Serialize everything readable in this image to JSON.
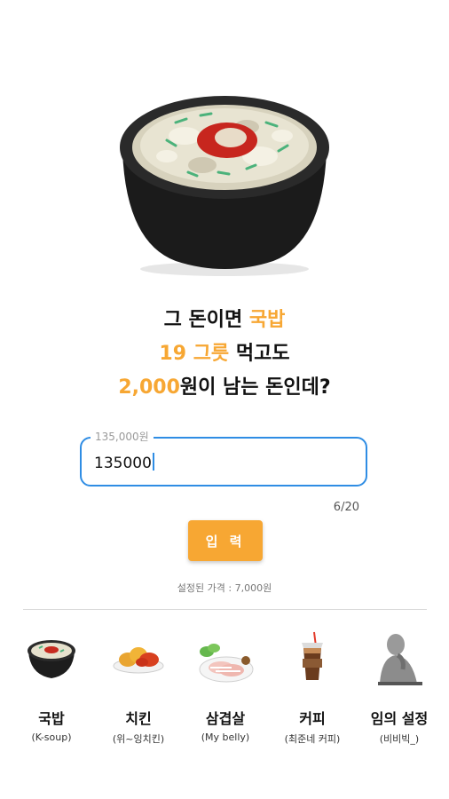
{
  "headline": {
    "line1_prefix": "그 돈이면 ",
    "item_name": "국밥",
    "line2_count": "19 그릇",
    "line2_suffix": " 먹고도",
    "line3_remainder": "2,000",
    "line3_suffix": "원이 남는 돈인데?"
  },
  "price_field": {
    "label": "135,000원",
    "value": "135000",
    "counter": "6/20"
  },
  "submit_label": "입 력",
  "price_note": "설정된 가격 : 7,000원",
  "categories": [
    {
      "name": "국밥",
      "sub": "(K-soup)",
      "icon": "gukbap-icon"
    },
    {
      "name": "치킨",
      "sub": "(위~잉치킨)",
      "icon": "chicken-icon"
    },
    {
      "name": "삼겹살",
      "sub": "(My belly)",
      "icon": "samgyeopsal-icon"
    },
    {
      "name": "커피",
      "sub": "(최준네 커피)",
      "icon": "coffee-icon"
    },
    {
      "name": "임의 설정",
      "sub": "(비비빅_)",
      "icon": "thinker-icon"
    }
  ],
  "colors": {
    "accent": "#f7a733",
    "field_border": "#2f8de4",
    "text": "#111111"
  }
}
